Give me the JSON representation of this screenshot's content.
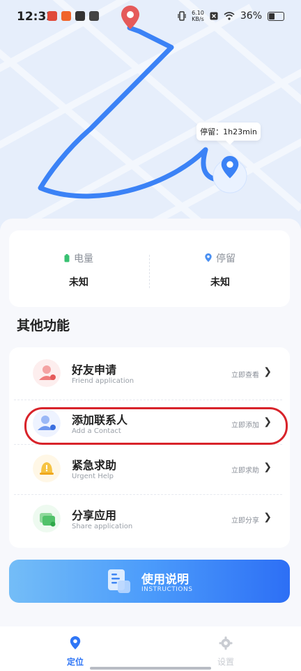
{
  "status_bar": {
    "time": "12:32",
    "speed_value": "6.10",
    "speed_unit": "KB/s",
    "battery": "36%"
  },
  "map": {
    "stay_label": "停留：1h23min"
  },
  "stats": {
    "battery_label": "电量",
    "battery_value": "未知",
    "stay_label": "停留",
    "stay_value": "未知"
  },
  "section_title": "其他功能",
  "functions": [
    {
      "title": "好友申请",
      "subtitle": "Friend application",
      "action": "立即查看"
    },
    {
      "title": "添加联系人",
      "subtitle": "Add a Contact",
      "action": "立即添加"
    },
    {
      "title": "紧急求助",
      "subtitle": "Urgent Help",
      "action": "立即求助"
    },
    {
      "title": "分享应用",
      "subtitle": "Share application",
      "action": "立即分享"
    }
  ],
  "instructions": {
    "title": "使用说明",
    "subtitle": "INSTRUCTIONS"
  },
  "tabs": [
    {
      "label": "定位",
      "active": true
    },
    {
      "label": "设置",
      "active": false
    }
  ],
  "colors": {
    "accent": "#2f76f6",
    "highlight": "#d8232a"
  }
}
